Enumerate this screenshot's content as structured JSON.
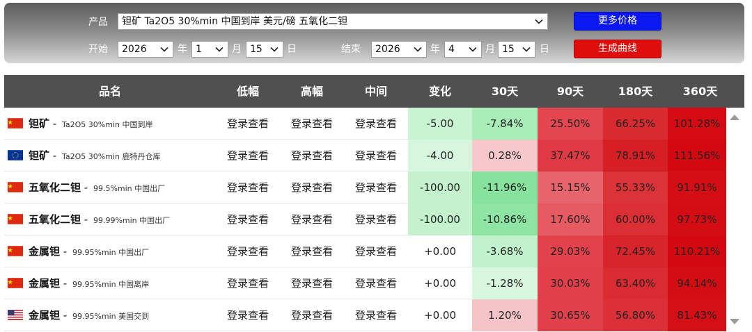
{
  "controls": {
    "product_label": "产品",
    "product_value": "钽矿 Ta2O5 30%min 中国到岸 美元/磅 五氧化二钽",
    "more_prices_button": "更多价格",
    "start_label": "开始",
    "start_year": "2026",
    "start_month": "1",
    "start_day": "15",
    "end_label": "结束",
    "end_year": "2026",
    "end_month": "4",
    "end_day": "15",
    "year_unit": "年",
    "month_unit": "月",
    "day_unit": "日",
    "generate_curve_button": "生成曲线"
  },
  "table": {
    "headers": [
      "品名",
      "低幅",
      "高幅",
      "中间",
      "变化",
      "30天",
      "90天",
      "180天",
      "360天"
    ],
    "login_text": "登录查看",
    "rows": [
      {
        "flag": "china-flag-icon",
        "name": "钽矿",
        "spec": "Ta2O5 30%min 中国到岸",
        "change": "-5.00",
        "d30": "-7.84%",
        "d90": "25.50%",
        "d180": "66.25%",
        "d360": "101.28%"
      },
      {
        "flag": "eu-flag-icon",
        "name": "钽矿",
        "spec": "Ta2O5 30%min 鹿特丹仓库",
        "change": "-4.00",
        "d30": "0.28%",
        "d90": "37.47%",
        "d180": "78.91%",
        "d360": "111.56%"
      },
      {
        "flag": "china-flag-icon",
        "name": "五氧化二钽",
        "spec": "99.5%min 中国出厂",
        "change": "-100.00",
        "d30": "-11.96%",
        "d90": "15.15%",
        "d180": "55.33%",
        "d360": "91.91%"
      },
      {
        "flag": "china-flag-icon",
        "name": "五氧化二钽",
        "spec": "99.99%min 中国出厂",
        "change": "-100.00",
        "d30": "-10.86%",
        "d90": "17.60%",
        "d180": "60.00%",
        "d360": "97.73%"
      },
      {
        "flag": "china-flag-icon",
        "name": "金属钽",
        "spec": "99.95%min 中国出厂",
        "change": "+0.00",
        "d30": "-3.68%",
        "d90": "29.03%",
        "d180": "72.45%",
        "d360": "110.21%"
      },
      {
        "flag": "china-flag-icon",
        "name": "金属钽",
        "spec": "99.95%min 中国离岸",
        "change": "+0.00",
        "d30": "-1.28%",
        "d90": "30.03%",
        "d180": "63.40%",
        "d360": "94.14%"
      },
      {
        "flag": "us-flag-icon",
        "name": "金属钽",
        "spec": "99.95%min 美国交到",
        "change": "+0.00",
        "d30": "1.20%",
        "d90": "30.65%",
        "d180": "56.80%",
        "d360": "81.43%"
      }
    ]
  },
  "colors": {
    "header_bg": "#505050",
    "btn_blue": "#0b18f2",
    "btn_red": "#e00d0d",
    "neg_light": "#c8f4d2",
    "neg_mid": "#a8ecb8",
    "neg_strong": "#86e29c",
    "pos_light": "#f6c8cc",
    "red_90": "#e3464f",
    "red_180": "#d92a30",
    "red_360": "#d40b12"
  }
}
